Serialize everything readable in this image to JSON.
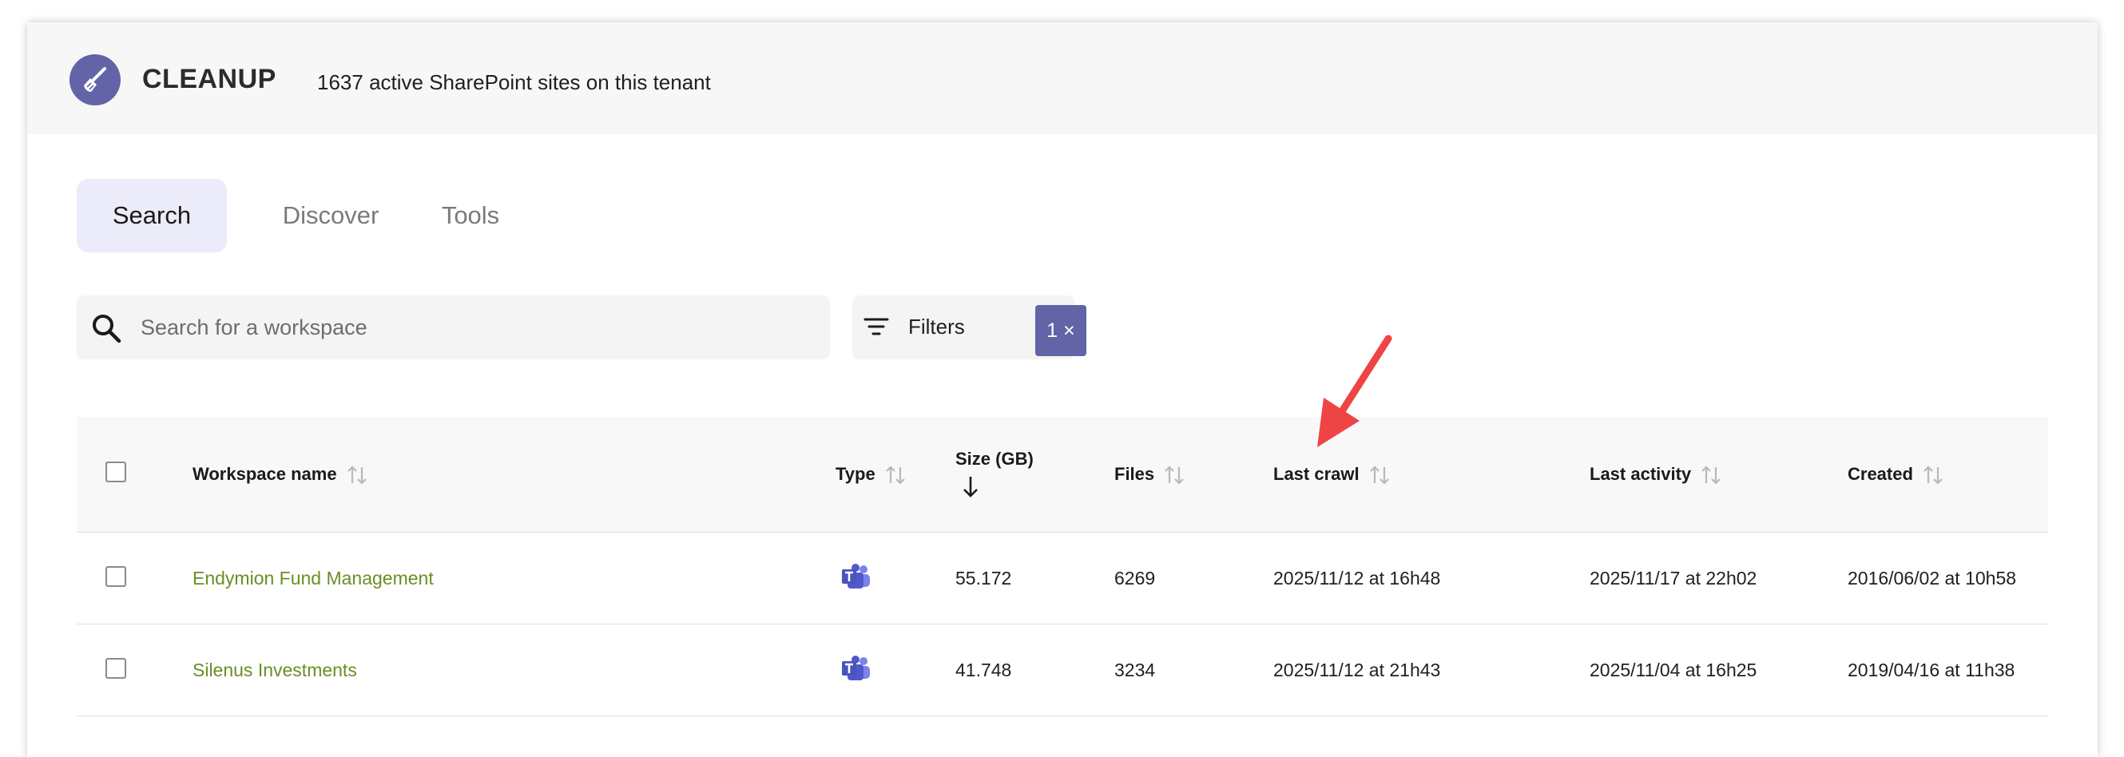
{
  "app": {
    "title": "CLEANUP",
    "tenant_info": "1637 active SharePoint sites on this tenant",
    "logo_icon": "broom-icon",
    "accent_color": "#6264a7"
  },
  "tabs": [
    {
      "label": "Search",
      "active": true
    },
    {
      "label": "Discover",
      "active": false
    },
    {
      "label": "Tools",
      "active": false
    }
  ],
  "search": {
    "placeholder": "Search for a workspace",
    "value": ""
  },
  "filters": {
    "label": "Filters",
    "badge": "1 ×"
  },
  "table": {
    "columns": [
      {
        "label": "Workspace name",
        "sort": "none"
      },
      {
        "label": "Type",
        "sort": "none"
      },
      {
        "label": "Size (GB)",
        "sort": "desc"
      },
      {
        "label": "Files",
        "sort": "none"
      },
      {
        "label": "Last crawl",
        "sort": "none"
      },
      {
        "label": "Last activity",
        "sort": "none"
      },
      {
        "label": "Created",
        "sort": "none"
      }
    ],
    "rows": [
      {
        "name": "Endymion Fund Management",
        "type_icon": "teams-icon",
        "size": "55.172",
        "files": "6269",
        "last_crawl": "2025/11/12 at 16h48",
        "last_activity": "2025/11/17 at 22h02",
        "created": "2016/06/02 at 10h58"
      },
      {
        "name": "Silenus Investments",
        "type_icon": "teams-icon",
        "size": "41.748",
        "files": "3234",
        "last_crawl": "2025/11/12 at 21h43",
        "last_activity": "2025/11/04 at 16h25",
        "created": "2019/04/16 at 11h38"
      }
    ]
  },
  "annotation": {
    "arrow_color": "#ef4444",
    "points_to": "Last crawl"
  }
}
